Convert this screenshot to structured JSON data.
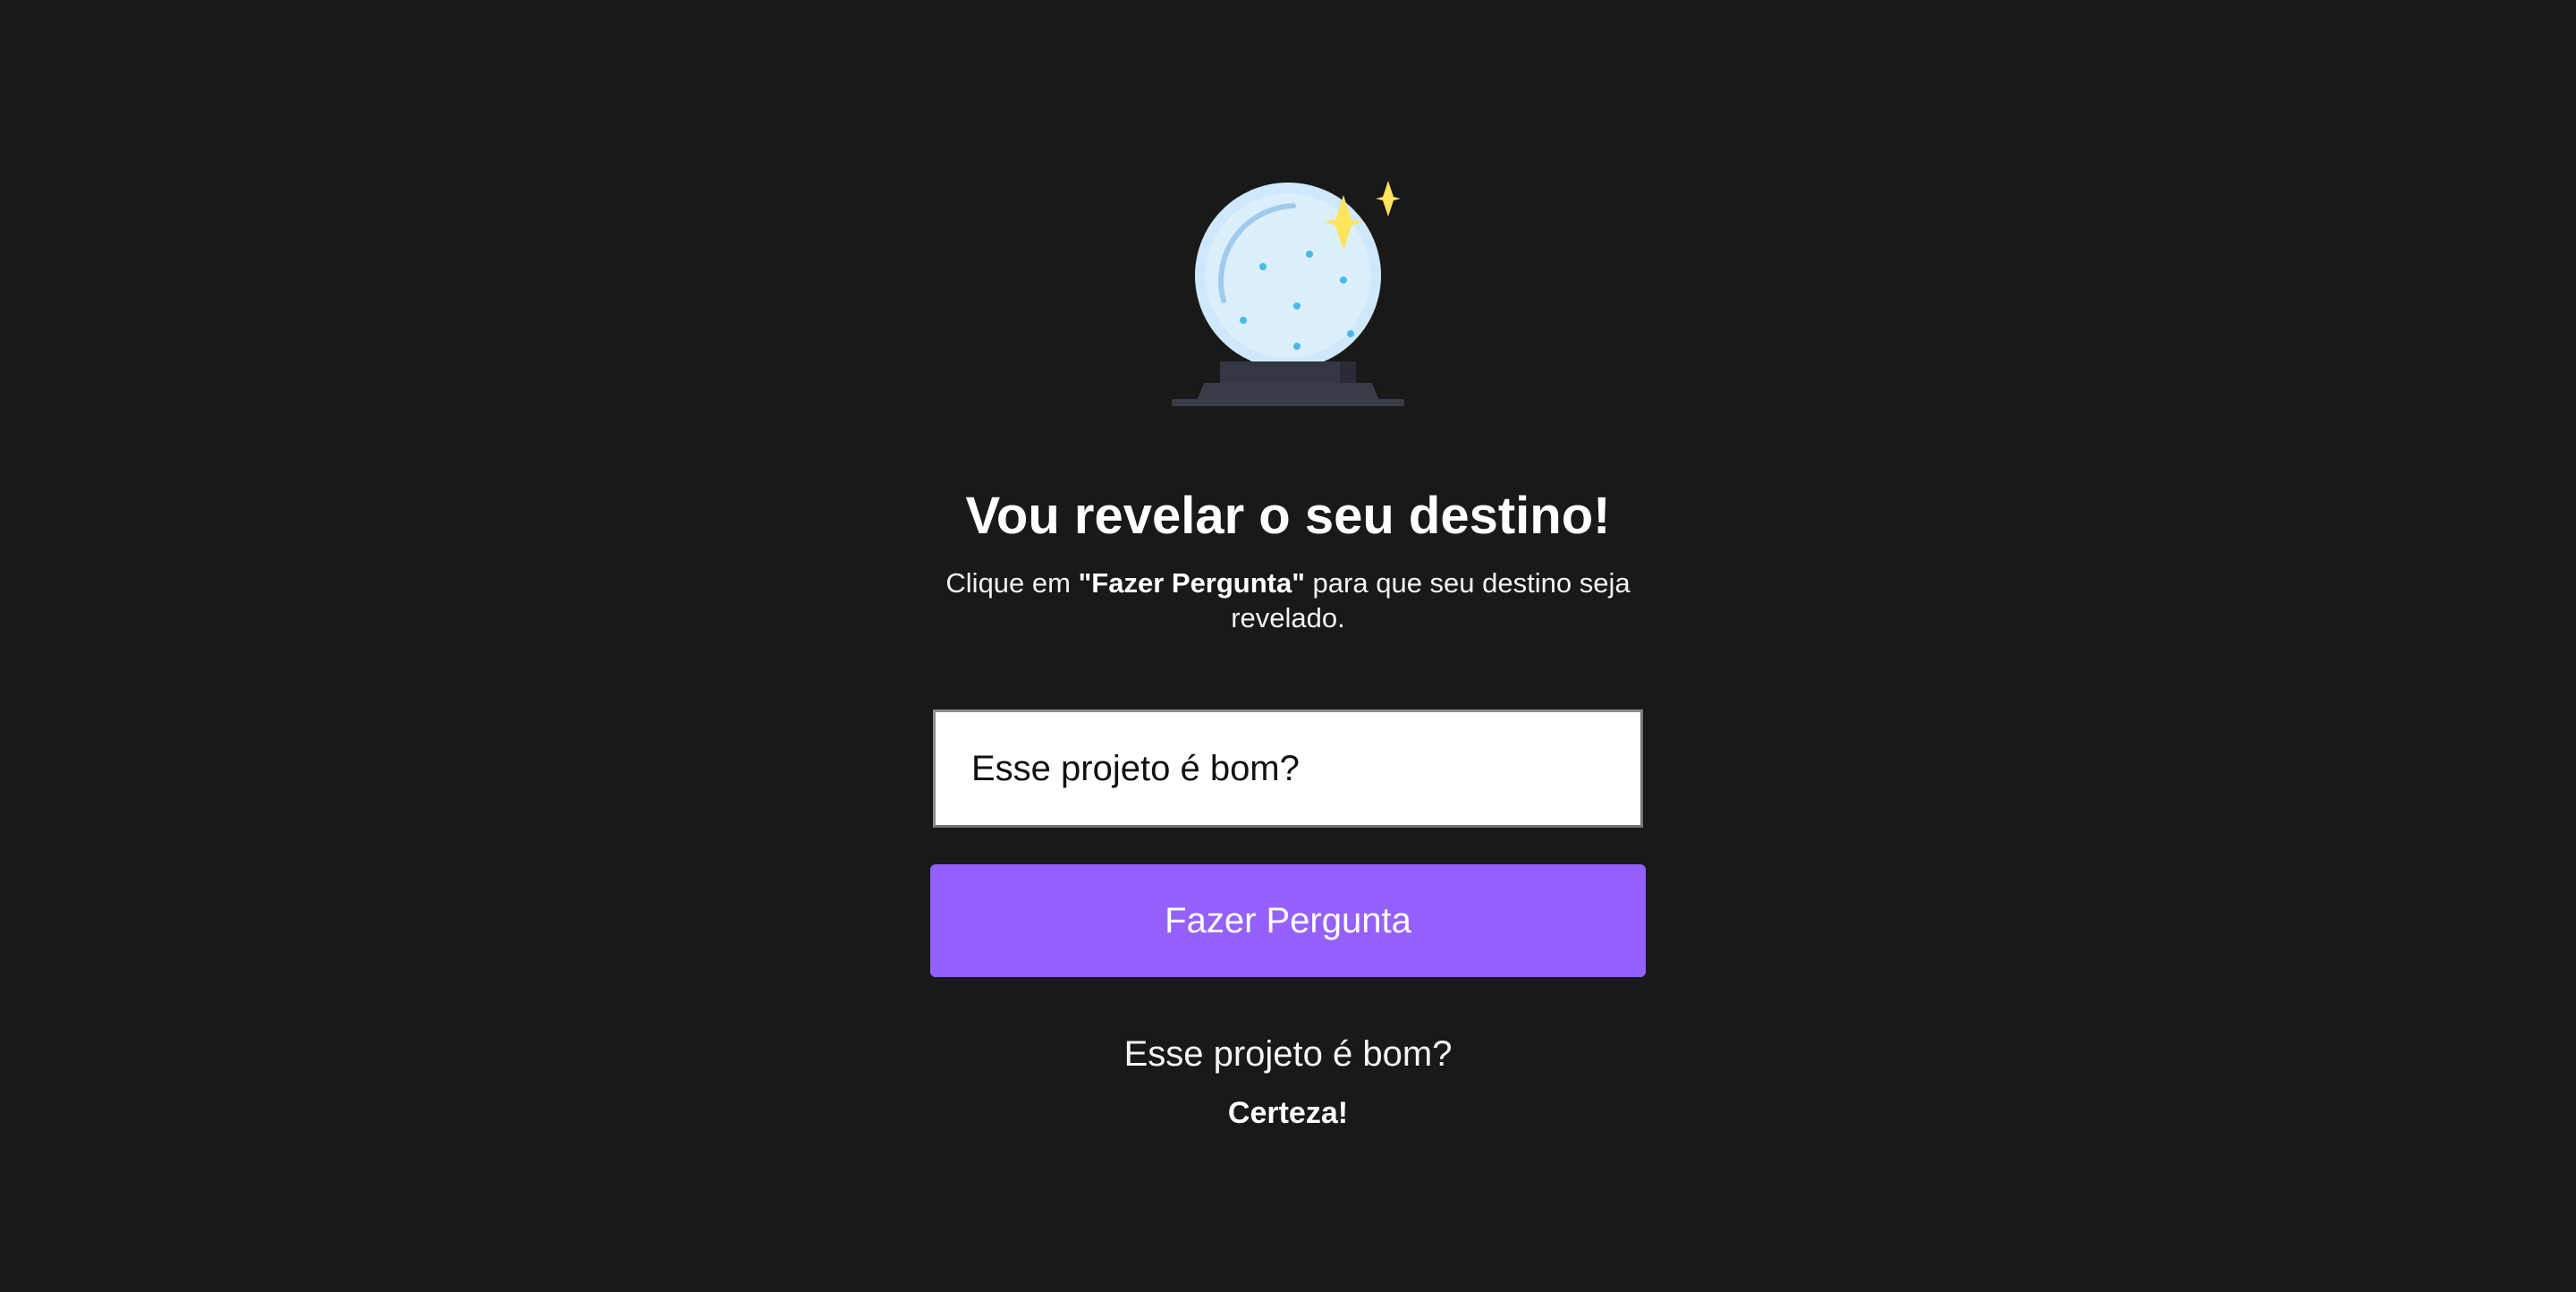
{
  "hero": {
    "title": "Vou revelar o seu destino!",
    "subtitle_before": "Clique em ",
    "subtitle_highlight": "\"Fazer Pergunta\"",
    "subtitle_after": " para que seu destino seja revelado."
  },
  "form": {
    "question_value": "Esse projeto é bom?",
    "button_label": "Fazer Pergunta"
  },
  "result": {
    "question": "Esse projeto é bom?",
    "answer": "Certeza!"
  },
  "icons": {
    "main": "crystal-ball-icon",
    "decoration": "sparkle-icon"
  },
  "colors": {
    "background": "#191919",
    "accent": "#9461fe",
    "sparkle": "#ffe45c",
    "ball": "#d6ecfc",
    "ball_dots": "#4cb8ea",
    "base": "#3b3c4a"
  }
}
